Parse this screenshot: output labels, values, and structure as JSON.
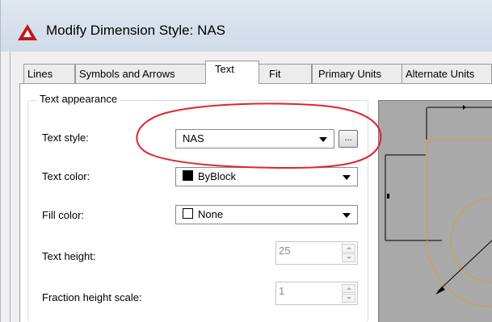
{
  "window": {
    "title": "Modify Dimension Style: NAS"
  },
  "tabs": [
    {
      "label": "Lines",
      "active": false
    },
    {
      "label": "Symbols and Arrows",
      "active": false
    },
    {
      "label": "Text",
      "active": true
    },
    {
      "label": "Fit",
      "active": false
    },
    {
      "label": "Primary Units",
      "active": false
    },
    {
      "label": "Alternate Units",
      "active": false
    }
  ],
  "text_appearance": {
    "group_label": "Text appearance",
    "text_style": {
      "label": "Text style:",
      "value": "NAS",
      "browse_label": "..."
    },
    "text_color": {
      "label": "Text color:",
      "value": "ByBlock",
      "swatch_color": "#000000"
    },
    "fill_color": {
      "label": "Fill color:",
      "value": "None",
      "swatch_color": "#ffffff"
    },
    "text_height": {
      "label": "Text height:",
      "value": "25"
    },
    "fraction_height_scale": {
      "label": "Fraction height scale:",
      "value": "1"
    }
  },
  "colors": {
    "annotation": "#e0242a",
    "preview_background": "#a9a9a9",
    "preview_geometry": "#c9a23a",
    "app_icon": "#c4161c"
  },
  "icons": {
    "app": "autocad-logo-icon",
    "dropdown": "chevron-down-icon",
    "spin_up": "spin-up-icon",
    "spin_down": "spin-down-icon"
  }
}
